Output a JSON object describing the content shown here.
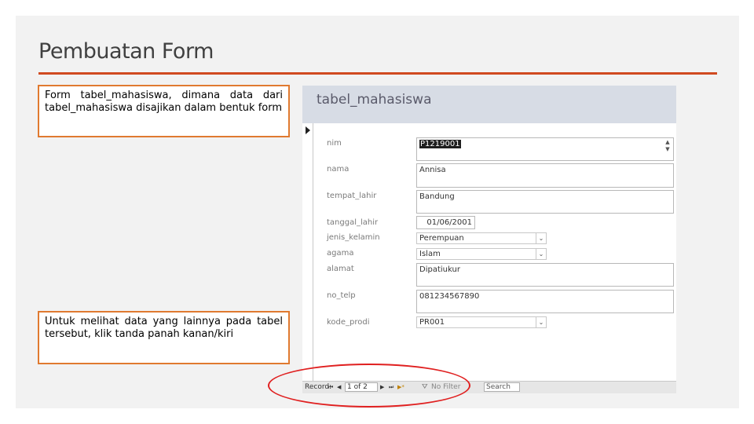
{
  "slide": {
    "title": "Pembuatan Form",
    "note_top": "Form tabel_mahasiswa, dimana data dari tabel_mahasiswa disajikan dalam bentuk form",
    "note_bottom": "Untuk melihat data yang lainnya pada tabel tersebut, klik tanda panah kanan/kiri"
  },
  "form": {
    "title": "tabel_mahasiswa",
    "fields": [
      {
        "label": "nim",
        "value": "P1219001"
      },
      {
        "label": "nama",
        "value": "Annisa"
      },
      {
        "label": "tempat_lahir",
        "value": "Bandung"
      },
      {
        "label": "tanggal_lahir",
        "value": "01/06/2001"
      },
      {
        "label": "jenis_kelamin",
        "value": "Perempuan"
      },
      {
        "label": "agama",
        "value": "Islam"
      },
      {
        "label": "alamat",
        "value": "Dipatiukur"
      },
      {
        "label": "no_telp",
        "value": "081234567890"
      },
      {
        "label": "kode_prodi",
        "value": "PR001"
      }
    ]
  },
  "nav": {
    "record_label": "Record:",
    "first": "⏮",
    "prev": "◀",
    "position": "1 of 2",
    "next": "▶",
    "last": "⏭",
    "new": "▶*",
    "filter": "No Filter",
    "search": "Search"
  },
  "colors": {
    "accent": "#d04a20",
    "note_border": "#e07a30",
    "highlight_ellipse": "#e02020"
  }
}
